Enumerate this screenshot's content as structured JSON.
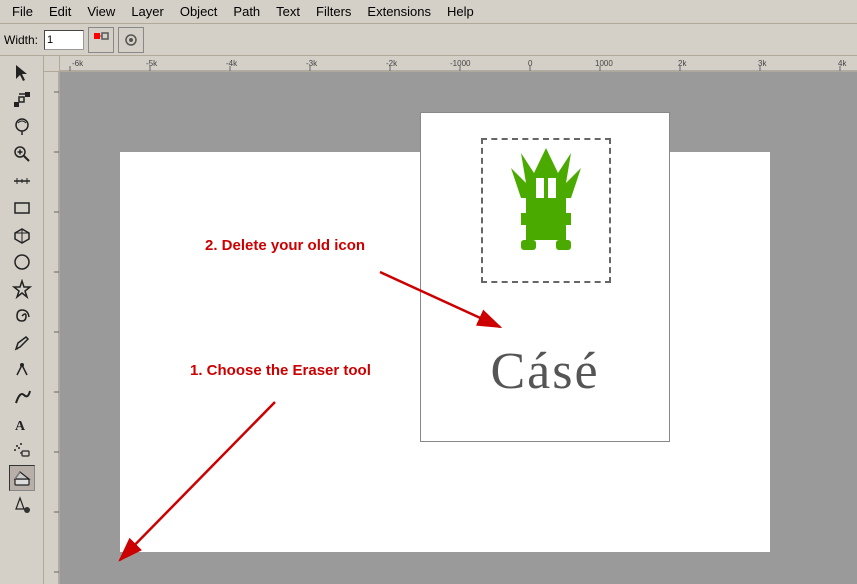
{
  "menubar": {
    "items": [
      "File",
      "Edit",
      "View",
      "Layer",
      "Object",
      "Path",
      "Text",
      "Filters",
      "Extensions",
      "Help"
    ]
  },
  "toolbar": {
    "width_label": "Width:",
    "width_value": "1",
    "snap_btn": "⛶",
    "node_btn": "◈"
  },
  "toolbox": {
    "tools": [
      {
        "name": "select-tool",
        "icon": "↖",
        "active": false
      },
      {
        "name": "node-tool",
        "icon": "◇",
        "active": false
      },
      {
        "name": "tweak-tool",
        "icon": "〰",
        "active": false
      },
      {
        "name": "zoom-tool",
        "icon": "🔍",
        "active": false
      },
      {
        "name": "measure-tool",
        "icon": "📏",
        "active": false
      },
      {
        "name": "rect-tool",
        "icon": "□",
        "active": false
      },
      {
        "name": "3d-box-tool",
        "icon": "⬡",
        "active": false
      },
      {
        "name": "circle-tool",
        "icon": "○",
        "active": false
      },
      {
        "name": "star-tool",
        "icon": "☆",
        "active": false
      },
      {
        "name": "spiral-tool",
        "icon": "◎",
        "active": false
      },
      {
        "name": "pencil-tool",
        "icon": "✏",
        "active": false
      },
      {
        "name": "pen-tool",
        "icon": "✒",
        "active": false
      },
      {
        "name": "calligraphy-tool",
        "icon": "🖊",
        "active": false
      },
      {
        "name": "text-tool",
        "icon": "A",
        "active": false
      },
      {
        "name": "spray-tool",
        "icon": "⋯",
        "active": false
      },
      {
        "name": "eraser-tool",
        "icon": "⬜",
        "active": true
      },
      {
        "name": "fill-tool",
        "icon": "⬛",
        "active": false
      }
    ]
  },
  "annotations": {
    "step1": "1. Choose the Eraser tool",
    "step2": "2. Delete your old icon"
  },
  "logo": {
    "text": "Cásé"
  },
  "ruler": {
    "marks": [
      "-6k",
      "-5k",
      "-4k",
      "-3k",
      "-2k",
      "-1000",
      "0",
      "1000",
      "2k",
      "3k",
      "4k"
    ]
  }
}
